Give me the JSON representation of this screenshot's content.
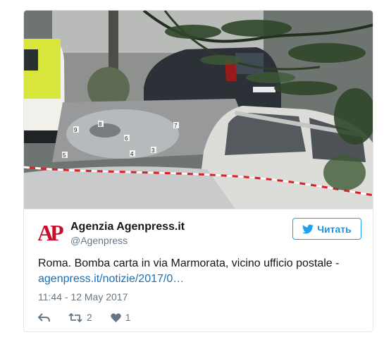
{
  "tweet": {
    "author_name": "Agenzia Agenpress.it",
    "author_handle": "@Agenpress",
    "logo_text": "AP",
    "follow_label": "Читать",
    "text": "Roma. Bomba carta in via Marmorata, vicino ufficio postale - ",
    "link_text": "agenpress.it/notizie/2017/0…",
    "timestamp": "11:44 - 12 May 2017",
    "retweet_count": "2",
    "like_count": "1",
    "photo_markers": [
      "9",
      "8",
      "6",
      "7",
      "5",
      "4",
      "3"
    ]
  },
  "icons": {
    "follow": "twitter-bird-icon",
    "reply": "reply-icon",
    "retweet": "retweet-icon",
    "like": "heart-icon"
  },
  "colors": {
    "accent": "#1da1f2",
    "link": "#1b6fb3",
    "muted": "#657786",
    "logo_red": "#c8102e",
    "border": "#e1e8ed"
  }
}
